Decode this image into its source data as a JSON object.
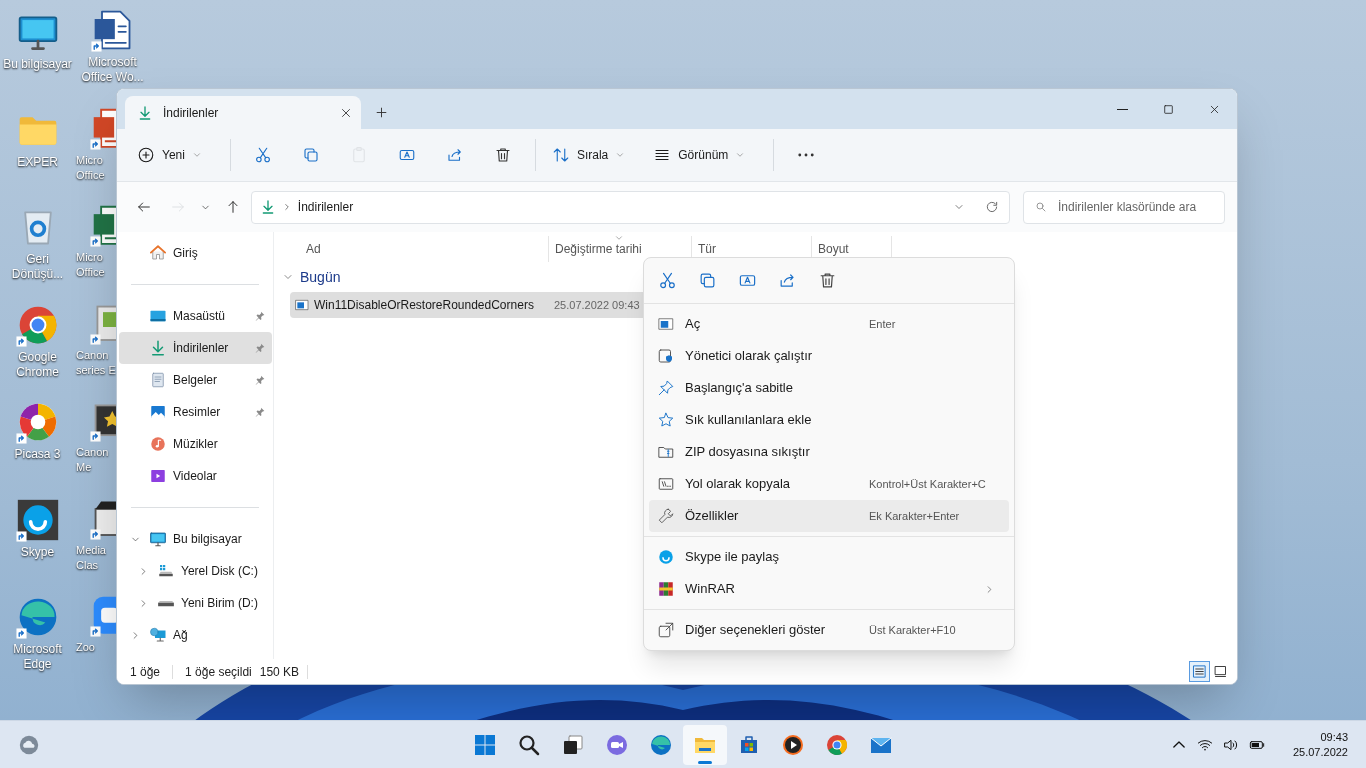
{
  "desktop_icons": [
    {
      "label": "Bu bilgisayar",
      "shortcut": false
    },
    {
      "label": "EXPER",
      "shortcut": false
    },
    {
      "label": "Geri Dönüşü...",
      "shortcut": false
    },
    {
      "label": "Google Chrome",
      "shortcut": true
    },
    {
      "label": "Picasa 3",
      "shortcut": true
    },
    {
      "label": "Skype",
      "shortcut": true
    },
    {
      "label": "Microsoft Edge",
      "shortcut": true
    }
  ],
  "desktop_icons_behind_window": [
    {
      "label": "Microsoft Office Wo...",
      "shortcut": true
    },
    {
      "label": "Micro Office",
      "shortcut": true
    },
    {
      "label": "Micro Office",
      "shortcut": true
    },
    {
      "label": "Canon series E",
      "shortcut": true
    },
    {
      "label": "Canon Me",
      "shortcut": true
    },
    {
      "label": "Media Clas",
      "shortcut": true
    },
    {
      "label": "Zoo",
      "shortcut": true
    }
  ],
  "window": {
    "tabs": [
      {
        "title": "İndirilenler",
        "selected": true
      }
    ],
    "command_bar": [
      {
        "kind": "menu",
        "label": "Yeni"
      },
      {
        "kind": "separator"
      },
      {
        "kind": "icon",
        "disabled": false
      },
      {
        "kind": "icon",
        "disabled": false
      },
      {
        "kind": "icon",
        "disabled": true
      },
      {
        "kind": "icon",
        "disabled": false
      },
      {
        "kind": "icon",
        "disabled": false
      },
      {
        "kind": "icon",
        "disabled": false
      },
      {
        "kind": "separator"
      },
      {
        "kind": "menu",
        "label": "Sırala"
      },
      {
        "kind": "menu",
        "label": "Görünüm"
      },
      {
        "kind": "separator"
      },
      {
        "kind": "icon",
        "disabled": false
      }
    ],
    "navigation": [
      {
        "disabled": false
      },
      {
        "disabled": true
      },
      {
        "disabled": false
      },
      {
        "disabled": false
      }
    ],
    "address": {
      "path": [
        "İndirilenler"
      ]
    },
    "search": {
      "placeholder": "İndirilenler klasöründe ara"
    },
    "sidebar": [
      {
        "items": [
          {
            "label": "Giriş",
            "selected": false
          }
        ]
      },
      {
        "items": [
          {
            "label": "Masaüstü",
            "pinned": true,
            "selected": false
          },
          {
            "label": "İndirilenler",
            "pinned": true,
            "selected": true
          },
          {
            "label": "Belgeler",
            "pinned": true,
            "selected": false
          },
          {
            "label": "Resimler",
            "pinned": true,
            "selected": false
          },
          {
            "label": "Müzikler",
            "pinned": false,
            "selected": false
          },
          {
            "label": "Videolar",
            "pinned": false,
            "selected": false
          }
        ]
      },
      {
        "items": [
          {
            "label": "Bu bilgisayar",
            "expanded": true,
            "selected": false,
            "children": [
              {
                "label": "Yerel Disk (C:)",
                "expanded": false,
                "selected": false
              },
              {
                "label": "Yeni Birim (D:)",
                "expanded": false,
                "selected": false
              }
            ]
          },
          {
            "label": "Ağ",
            "expanded": false,
            "selected": false
          }
        ]
      }
    ],
    "columns": [
      {
        "label": "Ad"
      },
      {
        "label": "Değiştirme tarihi",
        "sorted": true
      },
      {
        "label": "Tür"
      },
      {
        "label": "Boyut"
      }
    ],
    "groups": [
      {
        "label": "Bugün",
        "expanded": true,
        "files": [
          {
            "name": "Win11DisableOrRestoreRoundedCorners",
            "modified": "25.07.2022 09:43",
            "selected": true
          }
        ]
      }
    ],
    "status_bar": {
      "count": "1 öğe",
      "selection": "1 öğe seçildi",
      "size": "150 KB",
      "views": [
        {
          "selected": true
        },
        {
          "selected": false
        }
      ]
    }
  },
  "context_menu": {
    "sections": [
      [
        {
          "label": "Aç",
          "shortcut": "Enter",
          "selected": false
        },
        {
          "label": "Yönetici olarak çalıştır",
          "selected": false
        },
        {
          "label": "Başlangıç'a sabitle",
          "selected": false
        },
        {
          "label": "Sık kullanılanlara ekle",
          "selected": false
        },
        {
          "label": "ZIP dosyasına sıkıştır",
          "selected": false
        },
        {
          "label": "Yol olarak kopyala",
          "shortcut": "Kontrol+Üst Karakter+C",
          "selected": false
        },
        {
          "label": "Özellikler",
          "shortcut": "Ek Karakter+Enter",
          "selected": true
        }
      ],
      [
        {
          "label": "Skype ile paylaş",
          "selected": false
        },
        {
          "label": "WinRAR",
          "submenu": true,
          "selected": false
        }
      ],
      [
        {
          "label": "Diğer seçenekleri göster",
          "shortcut": "Üst Karakter+F10",
          "selected": false
        }
      ]
    ]
  },
  "taskbar": {
    "apps": [
      {
        "active": false
      },
      {
        "active": false
      },
      {
        "active": false
      },
      {
        "active": false
      },
      {
        "active": false
      },
      {
        "active": true
      },
      {
        "active": false
      },
      {
        "active": false
      },
      {
        "active": false
      },
      {
        "active": false
      }
    ],
    "clock": {
      "time": "09:43",
      "date": "25.07.2022"
    }
  }
}
